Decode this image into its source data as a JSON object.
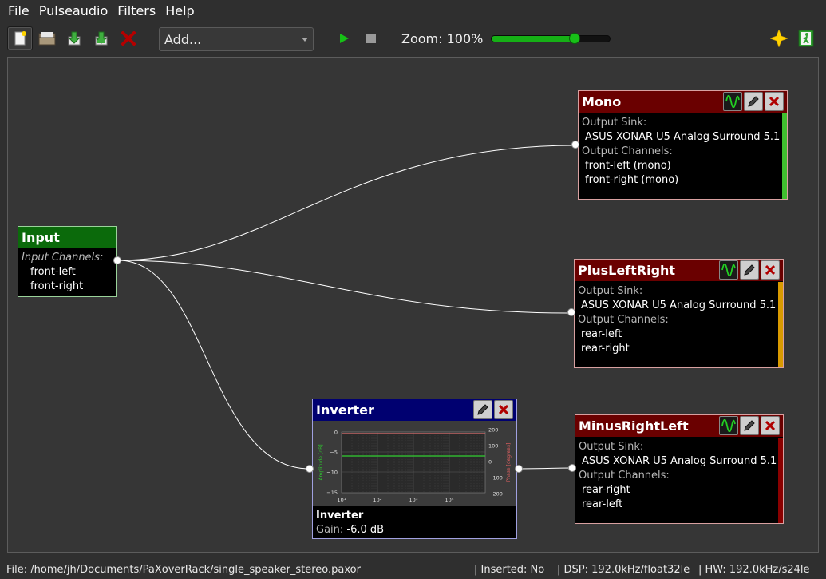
{
  "menu": [
    "File",
    "Pulseaudio",
    "Filters",
    "Help"
  ],
  "toolbar": {
    "add_combo": "Add...",
    "zoom_label": "Zoom: 100%",
    "zoom_level": 0.7
  },
  "nodes": {
    "input": {
      "title": "Input",
      "channels_label": "Input Channels:",
      "channels": [
        "front-left",
        "front-right"
      ]
    },
    "mono": {
      "title": "Mono",
      "sink_label": "Output Sink:",
      "sink": "ASUS XONAR U5 Analog Surround 5.1",
      "channels_label": "Output Channels:",
      "channels": [
        "front-left (mono)",
        "front-right (mono)"
      ],
      "level_color": "#3fbf2f"
    },
    "plus": {
      "title": "PlusLeftRight",
      "sink_label": "Output Sink:",
      "sink": "ASUS XONAR U5 Analog Surround 5.1",
      "channels_label": "Output Channels:",
      "channels": [
        "rear-left",
        "rear-right"
      ],
      "level_color": "#d99a00"
    },
    "minus": {
      "title": "MinusRightLeft",
      "sink_label": "Output Sink:",
      "sink": "ASUS XONAR U5 Analog Surround 5.1",
      "channels_label": "Output Channels:",
      "channels": [
        "rear-right",
        "rear-left"
      ],
      "level_color": "#8a0000"
    },
    "inverter": {
      "title": "Inverter",
      "name": "Inverter",
      "gain_label": "Gain:",
      "gain": "-6.0 dB",
      "plot": {
        "ylabel_left": "Amplitude [dB]",
        "ylabel_right": "Phase [degrees]",
        "y_ticks_left": [
          "0",
          "−5",
          "−10",
          "−15"
        ],
        "y_ticks_right": [
          "200",
          "100",
          "0",
          "−100",
          "−200"
        ],
        "x_ticks": [
          "10¹",
          "10²",
          "10³",
          "10⁴"
        ]
      }
    }
  },
  "status": {
    "file": "File: /home/jh/Documents/PaXoverRack/single_speaker_stereo.paxor",
    "inserted": "| Inserted: No",
    "dsp": "| DSP: 192.0kHz/float32le",
    "hw": "| HW: 192.0kHz/s24le"
  },
  "colors": {
    "output_header": "#6a0000",
    "input_header": "#0a6a0a",
    "filter_header": "#000070",
    "accent_green": "#16b016"
  }
}
